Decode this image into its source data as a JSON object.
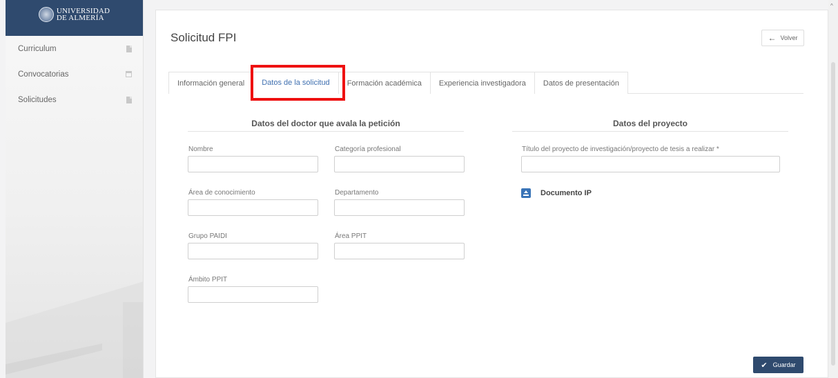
{
  "sidebar": {
    "logo_line1": "UNIVERSIDAD",
    "logo_line2": "DE ALMERÍA",
    "items": [
      {
        "label": "Curriculum",
        "icon": "document-icon"
      },
      {
        "label": "Convocatorias",
        "icon": "calendar-icon"
      },
      {
        "label": "Solicitudes",
        "icon": "document-icon"
      }
    ]
  },
  "header": {
    "title": "Solicitud FPI",
    "back_label": "Volver"
  },
  "tabs": [
    {
      "label": "Información general"
    },
    {
      "label": "Datos de la solicitud"
    },
    {
      "label": "Formación académica"
    },
    {
      "label": "Experiencia investigadora"
    },
    {
      "label": "Datos de presentación"
    }
  ],
  "active_tab": "Datos de la solicitud",
  "doctor_section": {
    "title": "Datos del doctor que avala la petición",
    "fields": {
      "nombre": {
        "label": "Nombre",
        "value": ""
      },
      "categoria": {
        "label": "Categoría profesional",
        "value": ""
      },
      "area": {
        "label": "Área de conocimiento",
        "value": ""
      },
      "departamento": {
        "label": "Departamento",
        "value": ""
      },
      "grupo": {
        "label": "Grupo PAIDI",
        "value": ""
      },
      "area_ppit": {
        "label": "Área PPIT",
        "value": ""
      },
      "ambito": {
        "label": "Ámbito PPIT",
        "value": ""
      }
    }
  },
  "project_section": {
    "title": "Datos del proyecto",
    "titulo_label": "Título del proyecto de investigación/proyecto de tesis a realizar *",
    "titulo_value": "",
    "document_label": "Documento IP"
  },
  "footer": {
    "save_label": "Guardar"
  },
  "colors": {
    "brand": "#2f4a6e",
    "active_tab": "#4070b0",
    "highlight": "#ee1111",
    "upload_icon": "#3a74b7"
  }
}
